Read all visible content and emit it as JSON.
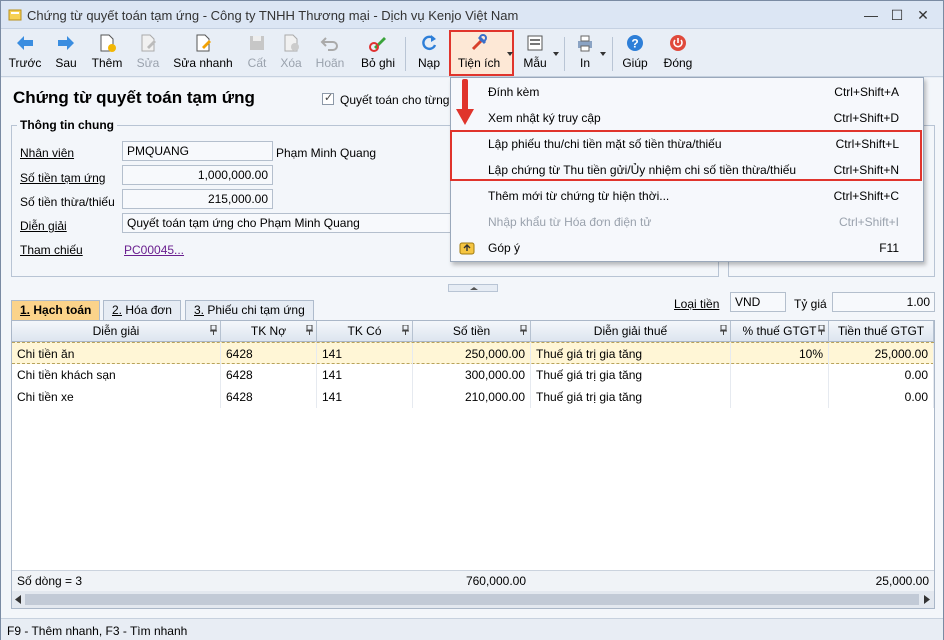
{
  "title": "Chứng từ quyết toán tạm ứng - Công ty TNHH Thương mại - Dịch vụ Kenjo Việt Nam",
  "window_controls": {
    "minimize": "—",
    "maximize": "☐",
    "close": "✕"
  },
  "toolbar": {
    "truoc": "Trước",
    "sau": "Sau",
    "them": "Thêm",
    "sua": "Sửa",
    "sua_nhanh": "Sửa nhanh",
    "cat": "Cất",
    "xoa": "Xóa",
    "hoan": "Hoãn",
    "bo_ghi": "Bỏ ghi",
    "nap": "Nạp",
    "tien_ich": "Tiện ích",
    "mau": "Mẫu",
    "in": "In",
    "giup": "Giúp",
    "dong": "Đóng"
  },
  "page_title": "Chứng từ quyết toán tạm ứng",
  "checkbox_label": "Quyết toán cho từng lầ",
  "info": {
    "group_title": "Thông tin chung",
    "nhan_vien_label": "Nhân viên",
    "nhan_vien_code": "PMQUANG",
    "nhan_vien_name": "Phạm Minh Quang",
    "so_tien_tam_ung_label": "Số tiền tạm ứng",
    "so_tien_tam_ung": "1,000,000.00",
    "so_tien_thua_thieu_label": "Số tiền thừa/thiếu",
    "so_tien_thua_thieu": "215,000.00",
    "dien_giai_label": "Diễn giải",
    "dien_giai": "Quyết toán tạm ứng cho Phạm Minh Quang",
    "tham_chieu_label": "Tham chiếu",
    "tham_chieu": "PC00045",
    "tham_chieu_more": "..."
  },
  "tabs": [
    {
      "num": "1.",
      "label": " Hạch toán"
    },
    {
      "num": "2.",
      "label": " Hóa đơn"
    },
    {
      "num": "3.",
      "label": " Phiếu chi tạm ứng"
    }
  ],
  "loai_tien_label": "Loại tiền",
  "loai_tien": "VND",
  "ty_gia_label": "Tỷ giá",
  "ty_gia": "1.00",
  "grid": {
    "headers": [
      "Diễn giải",
      "TK Nợ",
      "TK Có",
      "Số tiền",
      "Diễn giải thuế",
      "% thuế GTGT",
      "Tiền thuế GTGT"
    ],
    "rows": [
      {
        "dien_giai": "Chi tiền ăn",
        "tk_no": "6428",
        "tk_co": "141",
        "so_tien": "250,000.00",
        "dg_thue": "Thuế giá trị gia tăng",
        "pct": "10%",
        "tien_thue": "25,000.00"
      },
      {
        "dien_giai": "Chi tiền khách sạn",
        "tk_no": "6428",
        "tk_co": "141",
        "so_tien": "300,000.00",
        "dg_thue": "Thuế giá trị gia tăng",
        "pct": "",
        "tien_thue": "0.00"
      },
      {
        "dien_giai": "Chi  tiền xe",
        "tk_no": "6428",
        "tk_co": "141",
        "so_tien": "210,000.00",
        "dg_thue": "Thuế giá trị gia tăng",
        "pct": "",
        "tien_thue": "0.00"
      }
    ],
    "footer_count": "Số dòng = 3",
    "footer_total": "760,000.00",
    "footer_tax": "25,000.00"
  },
  "menu": [
    {
      "label": "Đính kèm",
      "shortcut": "Ctrl+Shift+A"
    },
    {
      "label": "Xem nhật ký truy cập",
      "shortcut": "Ctrl+Shift+D"
    },
    {
      "label": "Lập phiếu thu/chi tiền mặt số tiền thừa/thiếu",
      "shortcut": "Ctrl+Shift+L"
    },
    {
      "label": "Lập chứng từ Thu tiền gửi/Ủy nhiệm chi số tiền thừa/thiếu",
      "shortcut": "Ctrl+Shift+N"
    },
    {
      "label": "Thêm mới từ chứng từ hiện thời...",
      "shortcut": "Ctrl+Shift+C"
    },
    {
      "label": "Nhập khẩu từ Hóa đơn điện tử",
      "shortcut": "Ctrl+Shift+I"
    },
    {
      "label": "Góp ý",
      "shortcut": "F11"
    }
  ],
  "status_bar": "F9 - Thêm nhanh, F3 - Tìm nhanh",
  "colors": {
    "accent_red": "#e0342c",
    "tab_active": "#fbd38a",
    "row_selected": "#fff6d6",
    "link": "#6a1f8f"
  }
}
